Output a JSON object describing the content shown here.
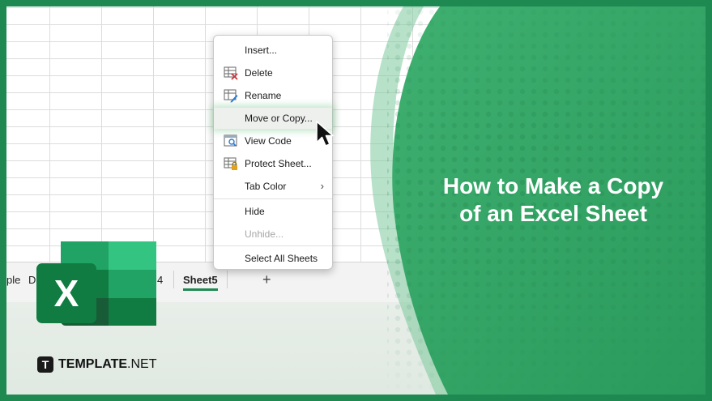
{
  "sheet_tabs": {
    "partial_left": "ple",
    "partial_second": "Da",
    "partial_third": "4",
    "active": "Sheet5",
    "add_label": "+"
  },
  "context_menu": {
    "items": [
      {
        "label": "Insert...",
        "icon": "none"
      },
      {
        "label": "Delete",
        "icon": "delete-sheet-icon"
      },
      {
        "label": "Rename",
        "icon": "rename-sheet-icon"
      },
      {
        "label": "Move or Copy...",
        "icon": "none",
        "highlighted": true
      },
      {
        "label": "View Code",
        "icon": "view-code-icon"
      },
      {
        "label": "Protect Sheet...",
        "icon": "protect-sheet-icon"
      },
      {
        "label": "Tab Color",
        "icon": "none",
        "submenu": true
      },
      {
        "label": "Hide",
        "icon": "none"
      },
      {
        "label": "Unhide...",
        "icon": "none",
        "disabled": true
      },
      {
        "label": "Select All Sheets",
        "icon": "none"
      }
    ],
    "submenu_arrow": "›"
  },
  "headline": {
    "line1": "How to Make a Copy",
    "line2": "of an Excel Sheet"
  },
  "logo": {
    "letter": "X",
    "icon": "excel-logo"
  },
  "brand": {
    "badge": "T",
    "name_bold": "TEMPLATE",
    "name_suffix": ".NET"
  },
  "colors": {
    "frame": "#1e8a52",
    "panel": "#2d9f62",
    "excel_dark": "#185c37",
    "excel_mid": "#21a366",
    "excel_light": "#33c481",
    "excel_badge": "#107c41"
  }
}
